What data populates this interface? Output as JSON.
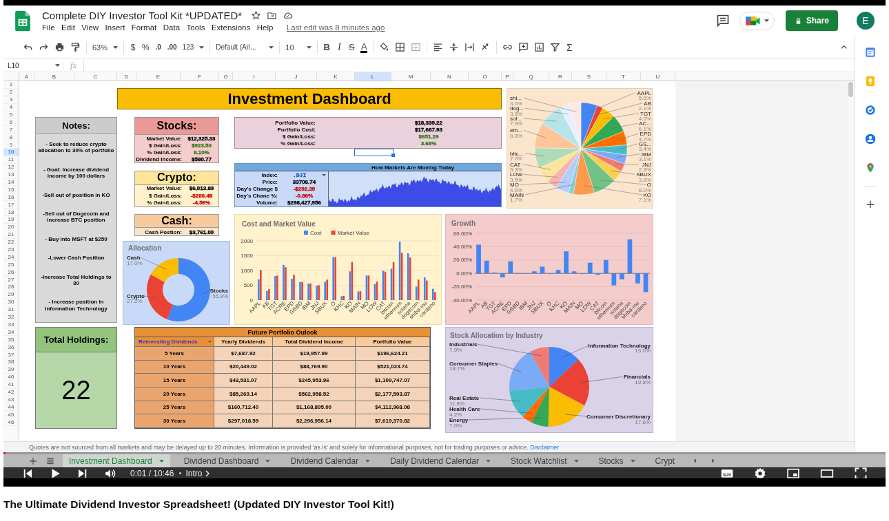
{
  "app": {
    "title": "Complete DIY Investor Tool Kit *UPDATED*",
    "menu": [
      "File",
      "Edit",
      "View",
      "Insert",
      "Format",
      "Data",
      "Tools",
      "Extensions",
      "Help"
    ],
    "last_edit": "Last edit was 8 minutes ago",
    "share": "Share",
    "avatar": "E"
  },
  "toolbar": {
    "zoom": "63%",
    "currency": "$",
    "percent": "%",
    "decrease_decimals": ".0",
    "increase_decimals": ".00",
    "number_format": "123",
    "font": "Default (Ari...",
    "font_size": "10",
    "bold": "B",
    "italic": "I",
    "strikethrough": "S",
    "text_color": "A",
    "functions": "Σ"
  },
  "formula_bar": {
    "name_box": "L10",
    "label": "fx"
  },
  "columns": [
    {
      "label": "A",
      "selected": false
    },
    {
      "label": "B",
      "selected": false
    },
    {
      "label": "C",
      "selected": false
    },
    {
      "label": "D",
      "selected": false
    },
    {
      "label": "E",
      "selected": false
    },
    {
      "label": "F",
      "selected": false
    },
    {
      "label": "G",
      "selected": false
    },
    {
      "label": "I",
      "selected": false
    },
    {
      "label": "J",
      "selected": false
    },
    {
      "label": "K",
      "selected": false
    },
    {
      "label": "L",
      "selected": true
    },
    {
      "label": "M",
      "selected": false
    },
    {
      "label": "N",
      "selected": false
    },
    {
      "label": "O",
      "selected": false
    },
    {
      "label": "P",
      "selected": false
    },
    {
      "label": "Q",
      "selected": false
    },
    {
      "label": "R",
      "selected": false
    },
    {
      "label": "S",
      "selected": false
    },
    {
      "label": "T",
      "selected": false
    },
    {
      "label": "U",
      "selected": false
    }
  ],
  "rows": [
    {
      "label": "1",
      "selected": false
    },
    {
      "label": "2",
      "selected": false
    },
    {
      "label": "3",
      "selected": false
    },
    {
      "label": "4",
      "selected": false
    },
    {
      "label": "5",
      "selected": false
    },
    {
      "label": "6",
      "selected": false
    },
    {
      "label": "7",
      "selected": false
    },
    {
      "label": "8",
      "selected": false
    },
    {
      "label": "9",
      "selected": false
    },
    {
      "label": "10",
      "selected": true
    },
    {
      "label": "11",
      "selected": false
    },
    {
      "label": "12",
      "selected": false
    },
    {
      "label": "13",
      "selected": false
    },
    {
      "label": "14",
      "selected": false
    },
    {
      "label": "15",
      "selected": false
    },
    {
      "label": "16",
      "selected": false
    },
    {
      "label": "17",
      "selected": false
    },
    {
      "label": "18",
      "selected": false
    },
    {
      "label": "19",
      "selected": false
    },
    {
      "label": "20",
      "selected": false
    },
    {
      "label": "21",
      "selected": false
    },
    {
      "label": "22",
      "selected": false
    },
    {
      "label": "23",
      "selected": false
    },
    {
      "label": "24",
      "selected": false
    },
    {
      "label": "25",
      "selected": false
    },
    {
      "label": "26",
      "selected": false
    },
    {
      "label": "27",
      "selected": false
    },
    {
      "label": "28",
      "selected": false
    },
    {
      "label": "29",
      "selected": false
    },
    {
      "label": "30",
      "selected": false
    },
    {
      "label": "31",
      "selected": false
    },
    {
      "label": "32",
      "selected": false
    },
    {
      "label": "33",
      "selected": false
    },
    {
      "label": "34",
      "selected": false
    },
    {
      "label": "35",
      "selected": false
    },
    {
      "label": "36",
      "selected": false
    },
    {
      "label": "37",
      "selected": false
    },
    {
      "label": "38",
      "selected": false
    },
    {
      "label": "39",
      "selected": false
    },
    {
      "label": "40",
      "selected": false
    },
    {
      "label": "41",
      "selected": false
    },
    {
      "label": "42",
      "selected": false
    },
    {
      "label": "43",
      "selected": false
    },
    {
      "label": "44",
      "selected": false
    },
    {
      "label": "45",
      "selected": false
    },
    {
      "label": "46",
      "selected": false
    }
  ],
  "dashboard": {
    "title": "Investment Dashboard",
    "holdings_pie": {
      "chart_data": {
        "type": "pie",
        "categories": [
          "AAPL",
          "AB",
          "TGT",
          "AC...",
          "EPD",
          "GS...",
          "IBM",
          "JNJ",
          "SBUX",
          "O",
          "KO",
          "MAIN",
          "MO",
          "LOW",
          "CAT",
          "bitc...",
          "eth...",
          "sol...",
          "dog...",
          "shi..."
        ],
        "values": [
          5.6,
          2.1,
          4.6,
          6.1,
          4.7,
          3.4,
          3.1,
          2.8,
          3.8,
          8.0,
          7.1,
          1.7,
          4.6,
          3.5,
          5.3,
          7.0,
          8.8,
          7.9,
          3.8,
          3.6
        ],
        "value_labels": [
          "5.6%",
          "2.1%",
          "4.6%",
          "6.1%",
          "4.7%",
          "3.4%",
          "3.1%",
          "2.8%",
          "3.8%",
          "8.0%",
          "7.1%",
          "1.7%",
          "4.6%",
          "3.5%",
          "5.3%",
          "7.0%",
          "8.8%",
          "7.9%",
          "3.8%",
          "3.6%"
        ]
      }
    },
    "notes": {
      "title": "Notes:",
      "items": [
        "- Seek to reduce crypto allocation to 30% of portfolio",
        "- Goal: Increase dividend income by 100 dollars",
        "-Sell out of position in KO",
        "-Sell out of Dogecoin and increase BTC position",
        "- Buy into MSFT at $250",
        "-Lower Cash Position",
        "-Increase Total Holdings to 30",
        "- Increase position in Information Technology"
      ]
    },
    "stocks": {
      "title": "Stocks:",
      "rows": [
        {
          "label": "Market Value:",
          "value": "$12,325.33",
          "color": "#000000"
        },
        {
          "label": "$ Gain/Loss:",
          "value": "$923.53",
          "color": "#38761d"
        },
        {
          "label": "% Gain/Loss:",
          "value": "8.10%",
          "color": "#38761d"
        },
        {
          "label": "Dividend Income:",
          "value": "$580.77",
          "color": "#000000"
        }
      ]
    },
    "portfolio": {
      "rows": [
        {
          "label": "Portfolio Value:",
          "value": "$18,339.22",
          "color": "#000000"
        },
        {
          "label": "Portfolio Cost:",
          "value": "$17,687.93",
          "color": "#000000"
        },
        {
          "label": "$ Gain/Loss:",
          "value": "$651.29",
          "color": "#38761d"
        },
        {
          "label": "% Gain/Loss:",
          "value": "3.68%",
          "color": "#38761d"
        }
      ]
    },
    "markets": {
      "title": "How Markets Are Moving Today",
      "rows": [
        {
          "label": "Index:",
          "value": ".DJI",
          "kind": "select",
          "color": "#1155cc"
        },
        {
          "label": "Price:",
          "value": "33706.74",
          "kind": "value",
          "color": "#000000"
        },
        {
          "label": "Day's Change $",
          "value": "-$292.30",
          "kind": "value",
          "color": "#cc0000"
        },
        {
          "label": "Day's Chane %:",
          "value": "-0.86%",
          "kind": "value",
          "color": "#cc0000"
        },
        {
          "label": "Volume:",
          "value": "$298,427,956",
          "kind": "value",
          "color": "#000000"
        }
      ]
    },
    "crypto": {
      "title": "Crypto:",
      "rows": [
        {
          "label": "Market Value:",
          "value": "$6,013.89",
          "color": "#000000"
        },
        {
          "label": "$ Gain/Loss:",
          "value": "-$286.48",
          "color": "#cc0000"
        },
        {
          "label": "% Gain/Loss:",
          "value": "-4.56%",
          "color": "#cc0000"
        }
      ]
    },
    "cash": {
      "title": "Cash:",
      "rows": [
        {
          "label": "Cash Postion:",
          "value": "$3,761.00",
          "color": "#000000"
        }
      ]
    },
    "cost_chart": {
      "chart_data": {
        "type": "bar",
        "title": "Cost and Market Value",
        "categories": [
          "AAPL",
          "AB",
          "TGT",
          "ACRE",
          "EPD",
          "GSBD",
          "IBM",
          "JNJ",
          "SBUX",
          "O",
          "KHC",
          "KO",
          "MAIN",
          "MO",
          "LOW",
          "CAT",
          "bitcoin",
          "ethereum",
          "solana",
          "dogecoin",
          "shiba-inu",
          "cardano"
        ],
        "series": [
          {
            "name": "Cost",
            "color": "#4285f4",
            "values": [
              700,
              310,
              810,
              1190,
              720,
              610,
              560,
              490,
              620,
              1450,
              130,
              970,
              290,
              830,
              540,
              990,
              1060,
              1970,
              1580,
              450,
              770,
              380
            ]
          },
          {
            "name": "Market Value",
            "color": "#ea4335",
            "values": [
              1020,
              370,
              830,
              1110,
              850,
              610,
              560,
              500,
              690,
              1450,
              140,
              1290,
              300,
              830,
              620,
              960,
              1280,
              1600,
              1440,
              690,
              660,
              270
            ]
          }
        ],
        "ylim": [
          0,
          2000
        ],
        "yticks": [
          0,
          500,
          1000,
          1500,
          2000
        ],
        "grid": true,
        "legend": "top"
      }
    },
    "growth_chart": {
      "chart_data": {
        "type": "bar",
        "title": "Growth",
        "categories": [
          "AAPL",
          "AB",
          "TGT",
          "ACRE",
          "EPD",
          "GSBD",
          "IBM",
          "JNJ",
          "SBUX",
          "O",
          "KHC",
          "KO",
          "MAIN",
          "MO",
          "LOW",
          "CAT",
          "bitcoin",
          "ethereum",
          "solana",
          "dogecoin",
          "shiba-inu",
          "cardano"
        ],
        "series": [
          {
            "color": "#4285f4",
            "values": [
              43,
              19,
              1,
              -6,
              18,
              0,
              0,
              3,
              10,
              0,
              5,
              33,
              3,
              0,
              16,
              -2,
              20,
              -18,
              -9,
              51,
              -15,
              -28
            ]
          }
        ],
        "ylim": [
          -40,
          60
        ],
        "yticks": [
          {
            "value": 60,
            "label": "60.00%"
          },
          {
            "value": 40,
            "label": "40.00%"
          },
          {
            "value": 20,
            "label": "20.00%"
          },
          {
            "value": 0,
            "label": "0.00%"
          },
          {
            "value": -20,
            "label": "-20.00%"
          },
          {
            "value": -40,
            "label": "-40.00%"
          }
        ],
        "grid": true
      }
    },
    "allocation": {
      "chart_data": {
        "type": "donut",
        "title": "Allocation",
        "categories": [
          "Stocks",
          "Crypto",
          "Cash"
        ],
        "values": [
          55.8,
          27.2,
          17.0
        ],
        "value_labels": [
          "55.8%",
          "27.2%",
          "17.0%"
        ]
      }
    },
    "total_holdings": {
      "title": "Total Holdings:",
      "value": "22"
    },
    "outlook": {
      "title": "Future Portfolio Oulook",
      "selector": "Reinvesting Dividends",
      "columns": [
        "Yearly Dividends",
        "Total Dividend Income",
        "Portfolio Value"
      ],
      "rows": [
        {
          "period": "5 Years",
          "cells": [
            "$7,687.92",
            "$19,957.99",
            "$196,624.21"
          ]
        },
        {
          "period": "10 Years",
          "cells": [
            "$20,449.02",
            "$88,769.90",
            "$521,023.74"
          ]
        },
        {
          "period": "15 Years",
          "cells": [
            "$43,531.07",
            "$245,953.96",
            "$1,109,747.07"
          ]
        },
        {
          "period": "20 Years",
          "cells": [
            "$85,269.14",
            "$562,958.52",
            "$2,177,503.87"
          ]
        },
        {
          "period": "25 Years",
          "cells": [
            "$160,712.40",
            "$1,168,895.00",
            "$4,112,968.08"
          ]
        },
        {
          "period": "30 Years",
          "cells": [
            "$297,018.59",
            "$2,296,956.14",
            "$7,619,370.82"
          ]
        }
      ]
    },
    "industry_chart": {
      "chart_data": {
        "type": "pie",
        "title": "Stock Allocation by Industry",
        "categories": [
          "Information Technology",
          "Financials",
          "Consumer Discretionary",
          "Energy",
          "Health Care",
          "Real Estate",
          "Consumer Staples",
          "Industrials"
        ],
        "values": [
          13.0,
          19.8,
          17.6,
          7.0,
          4.2,
          11.8,
          18.7,
          7.9
        ],
        "value_labels": [
          "13.0%",
          "19.8%",
          "17.6%",
          "7.0%",
          "4.2%",
          "11.8%",
          "18.7%",
          "7.9%"
        ]
      }
    }
  },
  "disclaimer": {
    "text": "Quotes are not sourced from all markets and may be delayed up to 20 minutes. Information is provided 'as is' and solely for informational purposes, not for trading purposes or advice.",
    "link": "Disclaimer"
  },
  "sheet_tabs": [
    {
      "label": "Investment Dashboard",
      "selected": true
    },
    {
      "label": "Dividend Dashboard",
      "selected": false
    },
    {
      "label": "Dividend Calendar",
      "selected": false
    },
    {
      "label": "Daily Dividend Calendar",
      "selected": false
    },
    {
      "label": "Stock Watchlist",
      "selected": false
    },
    {
      "label": "Stocks",
      "selected": false
    },
    {
      "label": "Crypt",
      "selected": false
    }
  ],
  "player": {
    "progress": {
      "level": 0.002
    },
    "time": "0:01 / 10:46",
    "chapter": "Intro"
  },
  "video_title": "The Ultimate Dividend Investor Spreadsheet! (Updated DIY Investor Tool Kit!)"
}
